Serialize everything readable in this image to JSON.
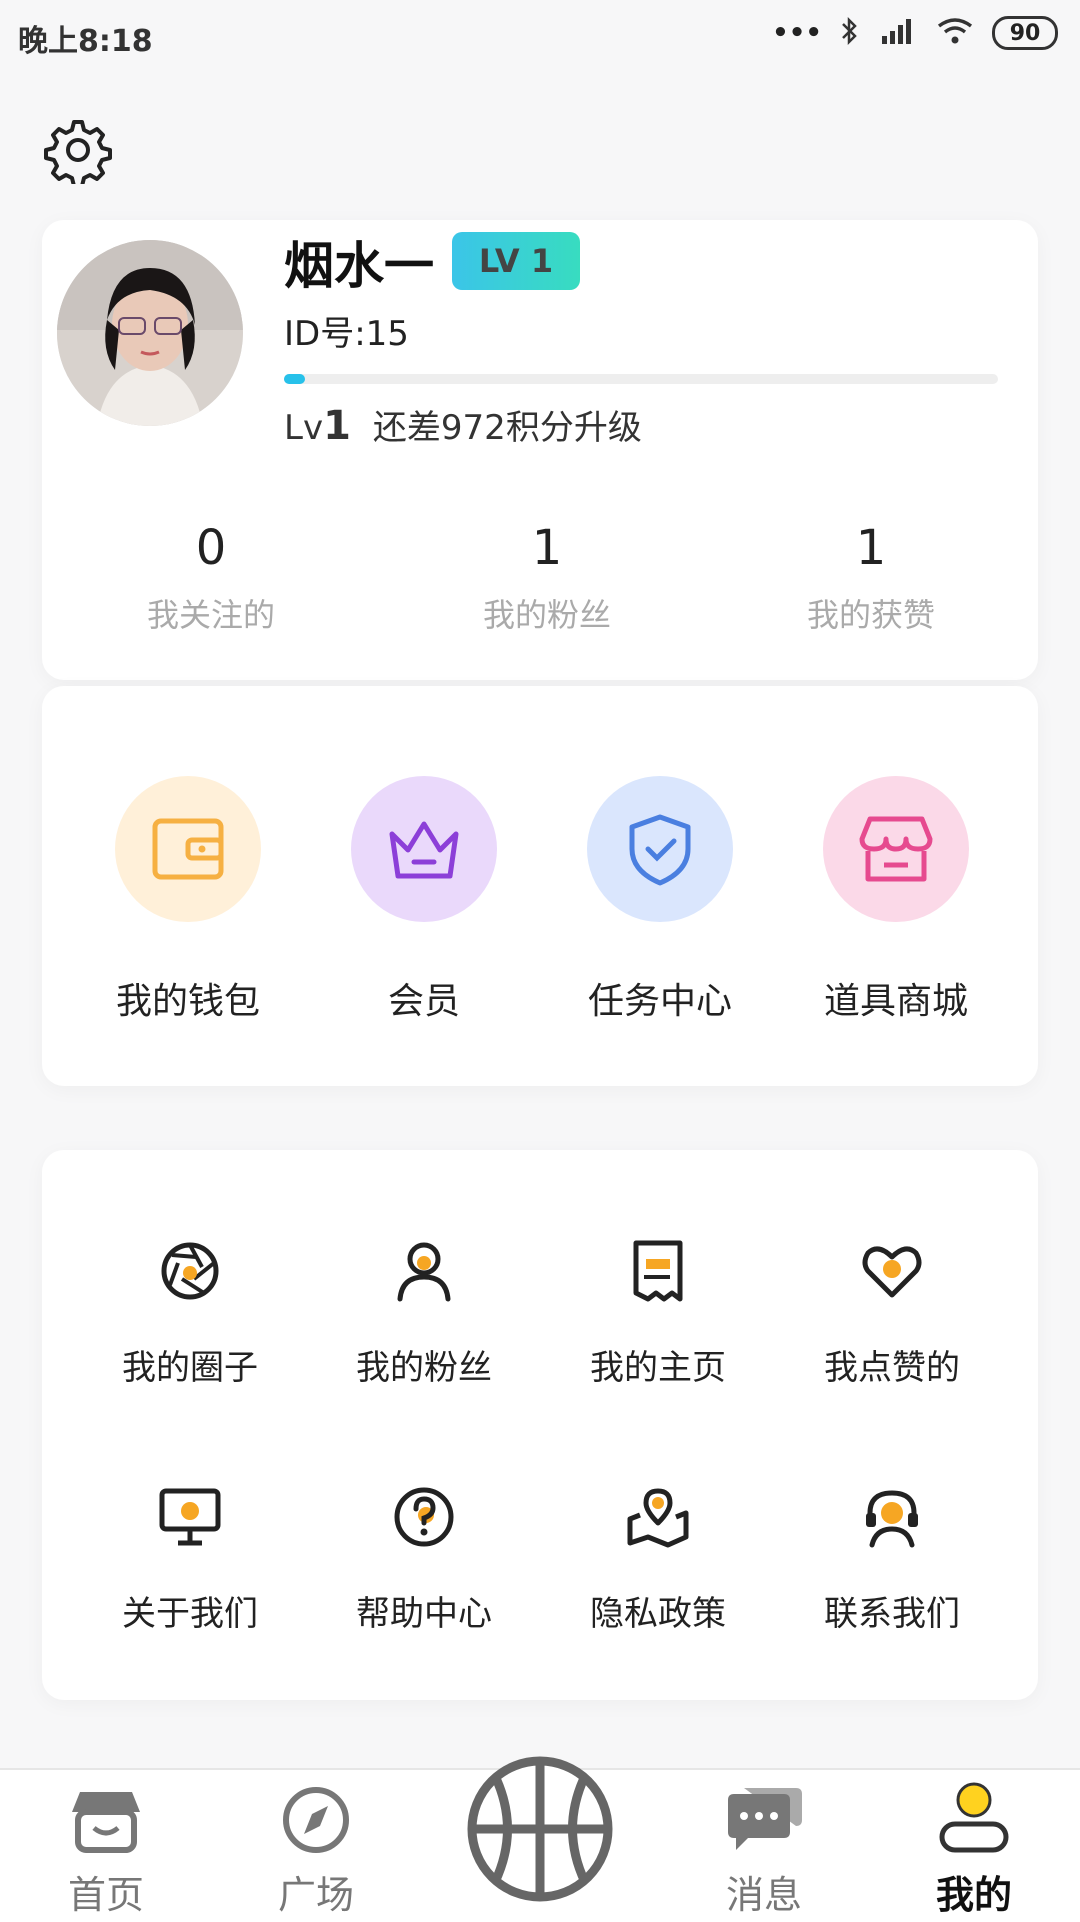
{
  "status_bar": {
    "time": "晚上8:18",
    "battery": "90"
  },
  "profile": {
    "name": "烟水一",
    "level_badge": "LV 1",
    "id_text": "ID号:15",
    "level_label": "Lv",
    "level_num": "1",
    "upgrade_hint": "还差972积分升级",
    "progress": 0.03
  },
  "stats": [
    {
      "value": "0",
      "label": "我关注的"
    },
    {
      "value": "1",
      "label": "我的粉丝"
    },
    {
      "value": "1",
      "label": "我的获赞"
    }
  ],
  "features": [
    {
      "label": "我的钱包",
      "icon": "wallet-icon",
      "color": "#f6b042",
      "bg": "#fff0d9"
    },
    {
      "label": "会员",
      "icon": "crown-icon",
      "color": "#8c3fd8",
      "bg": "#ead9fb"
    },
    {
      "label": "任务中心",
      "icon": "shield-check-icon",
      "color": "#4a7fe0",
      "bg": "#dae6fd"
    },
    {
      "label": "道具商城",
      "icon": "store-icon",
      "color": "#e64a8f",
      "bg": "#fbd9e8"
    }
  ],
  "menu": [
    {
      "label": "我的圈子",
      "icon": "aperture-icon"
    },
    {
      "label": "我的粉丝",
      "icon": "person-icon"
    },
    {
      "label": "我的主页",
      "icon": "receipt-icon"
    },
    {
      "label": "我点赞的",
      "icon": "heart-icon"
    },
    {
      "label": "关于我们",
      "icon": "monitor-icon"
    },
    {
      "label": "帮助中心",
      "icon": "question-icon"
    },
    {
      "label": "隐私政策",
      "icon": "location-map-icon"
    },
    {
      "label": "联系我们",
      "icon": "headset-icon"
    }
  ],
  "tabs": [
    {
      "label": "首页",
      "icon": "home-icon"
    },
    {
      "label": "广场",
      "icon": "compass-icon"
    },
    {
      "label": "",
      "icon": "basketball-icon"
    },
    {
      "label": "消息",
      "icon": "chat-icon"
    },
    {
      "label": "我的",
      "icon": "user-icon",
      "active": true
    }
  ],
  "accent": "#f6a623"
}
